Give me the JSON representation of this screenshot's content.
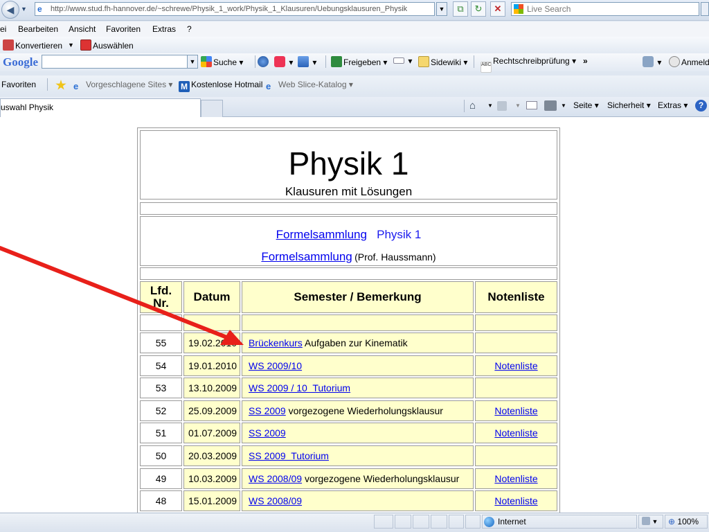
{
  "browser": {
    "url": "http://www.stud.fh-hannover.de/~schrewe/Physik_1_work/Physik_1_Klausuren/Uebungsklausuren_Physik",
    "live_search_placeholder": "Live Search",
    "menu": [
      "Datei",
      "Bearbeiten",
      "Ansicht",
      "Favoriten",
      "Extras",
      "?"
    ],
    "menu_visible": [
      "ei",
      "Bearbeiten",
      "Ansicht",
      "Favoriten",
      "Extras",
      "?"
    ],
    "convert_toolbar": {
      "convert": "Konvertieren",
      "select": "Auswählen"
    },
    "google_toolbar": {
      "logo": "Google",
      "search": "Suche",
      "share": "Freigeben",
      "sidewiki": "Sidewiki",
      "spellcheck": "Rechtschreibprüfung",
      "more": "»",
      "signin": "Anmeld"
    },
    "favorites_bar": {
      "favorites": "Favoriten",
      "suggested": "Vorgeschlagene Sites",
      "hotmail": "Kostenlose Hotmail",
      "webslice": "Web Slice-Katalog"
    },
    "tab_title": "uswahl Physik",
    "command_bar": {
      "page": "Seite",
      "security": "Sicherheit",
      "extras": "Extras"
    },
    "status": {
      "zone": "Internet",
      "zoom": "100%"
    }
  },
  "page": {
    "title": "Physik 1",
    "subtitle": "Klausuren mit Lösungen",
    "formula_link_1": "Formelsammlung",
    "formula_text_1": "Physik 1",
    "formula_link_2": "Formelsammlung",
    "formula_text_2": "(Prof. Haussmann)",
    "table": {
      "headers": {
        "nr_line1": "Lfd.",
        "nr_line2": "Nr.",
        "date": "Datum",
        "semester": "Semester / Bemerkung",
        "grades": "Notenliste"
      },
      "rows": [
        {
          "nr": "55",
          "date": "19.02.2010",
          "link": "Brückenkurs",
          "note": " Aufgaben zur Kinematik",
          "grades": ""
        },
        {
          "nr": "54",
          "date": "19.01.2010",
          "link": "WS 2009/10",
          "note": "",
          "grades": "Notenliste"
        },
        {
          "nr": "53",
          "date": "13.10.2009",
          "link": "WS 2009 / 10  Tutorium",
          "note": "",
          "grades": ""
        },
        {
          "nr": "52",
          "date": "25.09.2009",
          "link": "SS 2009",
          "note": " vorgezogene Wiederholungsklausur",
          "grades": "Notenliste"
        },
        {
          "nr": "51",
          "date": "01.07.2009",
          "link": "SS 2009",
          "note": "",
          "grades": "Notenliste"
        },
        {
          "nr": "50",
          "date": "20.03.2009",
          "link": "SS 2009  Tutorium",
          "note": "",
          "grades": ""
        },
        {
          "nr": "49",
          "date": "10.03.2009",
          "link": "WS 2008/09",
          "note": " vorgezogene Wiederholungsklausur",
          "grades": "Notenliste"
        },
        {
          "nr": "48",
          "date": "15.01.2009",
          "link": "WS 2008/09",
          "note": "",
          "grades": "Notenliste"
        }
      ]
    }
  },
  "colors": {
    "row_bg": "#ffffcc",
    "link": "#0000ee",
    "arrow": "#e8201a"
  }
}
